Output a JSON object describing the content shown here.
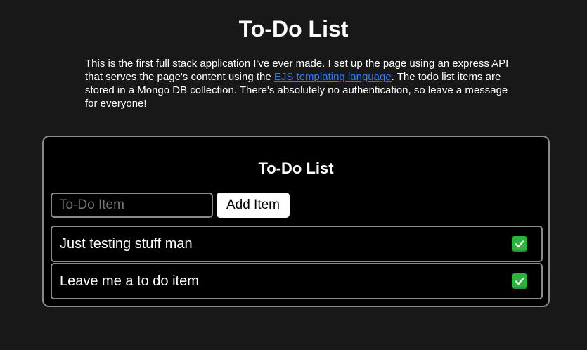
{
  "header": {
    "title": "To-Do List"
  },
  "intro": {
    "text_before_link": "This is the first full stack application I've ever made. I set up the page using an express API that serves the page's content using the ",
    "link_text": "EJS templating language",
    "text_after_link": ". The todo list items are stored in a Mongo DB collection. There's absolutely no authentication, so leave a message for everyone!"
  },
  "card": {
    "title": "To-Do List",
    "input": {
      "placeholder": "To-Do Item",
      "value": ""
    },
    "add_button_label": "Add Item",
    "items": [
      {
        "text": "Just testing stuff man",
        "status_icon": "white-check-mark-icon"
      },
      {
        "text": "Leave me a to do item",
        "status_icon": "white-check-mark-icon"
      }
    ]
  },
  "colors": {
    "page_background": "#181818",
    "card_background": "#000000",
    "border": "#8a8a8a",
    "link": "#2f7bff",
    "check_green": "#2bb33d"
  }
}
